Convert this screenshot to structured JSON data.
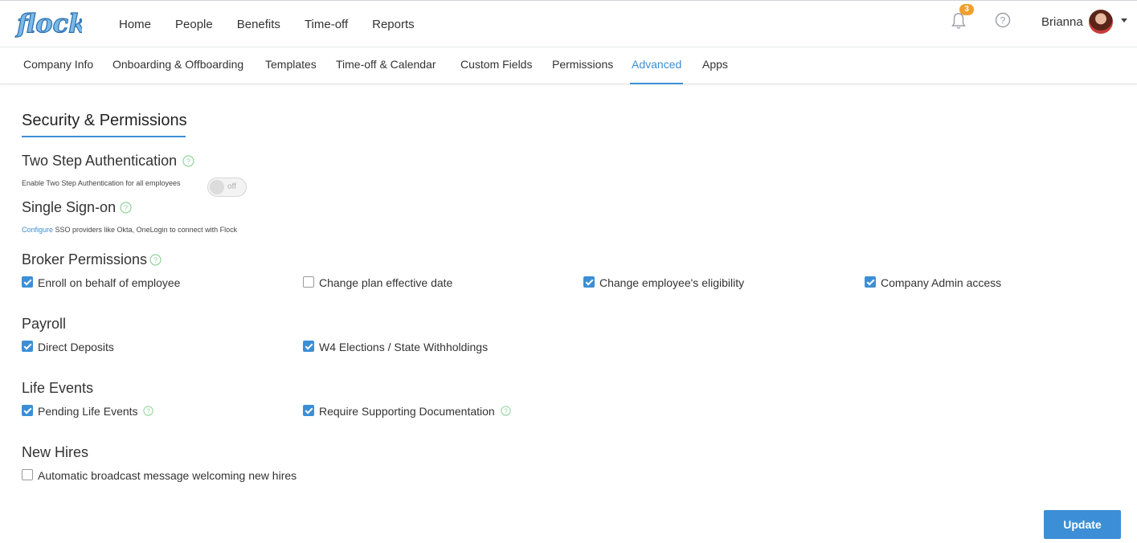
{
  "app": {
    "logo_text": "flock",
    "brand_color": "#3c8fd6",
    "badge_color": "#f0a030"
  },
  "header": {
    "nav": [
      "Home",
      "People",
      "Benefits",
      "Time-off",
      "Reports"
    ],
    "notifications_count": "3",
    "user_name": "Brianna"
  },
  "subnav": {
    "tabs": [
      "Company Info",
      "Onboarding & Offboarding",
      "Templates",
      "Time-off & Calendar",
      "Custom Fields",
      "Permissions",
      "Advanced",
      "Apps"
    ],
    "active": "Advanced"
  },
  "page": {
    "title": "Security & Permissions",
    "two_step": {
      "heading": "Two Step Authentication",
      "description": "Enable Two Step Authentication for all employees",
      "toggle_label": "off"
    },
    "sso": {
      "heading": "Single Sign-on",
      "configure_link": "Configure",
      "description": " SSO providers like Okta, OneLogin to connect with Flock"
    },
    "broker": {
      "heading": "Broker Permissions",
      "options": [
        {
          "label": "Enroll on behalf of employee",
          "checked": true
        },
        {
          "label": "Change plan effective date",
          "checked": false
        },
        {
          "label": "Change employee's eligibility",
          "checked": true
        },
        {
          "label": "Company Admin access",
          "checked": true
        }
      ]
    },
    "payroll": {
      "heading": "Payroll",
      "options": [
        {
          "label": "Direct Deposits",
          "checked": true
        },
        {
          "label": "W4 Elections / State Withholdings",
          "checked": true
        }
      ]
    },
    "life_events": {
      "heading": "Life Events",
      "options": [
        {
          "label": "Pending Life Events",
          "checked": true
        },
        {
          "label": "Require Supporting Documentation",
          "checked": true
        }
      ]
    },
    "new_hires": {
      "heading": "New Hires",
      "options": [
        {
          "label": "Automatic broadcast message welcoming new hires",
          "checked": false
        }
      ]
    },
    "update_button": "Update"
  }
}
